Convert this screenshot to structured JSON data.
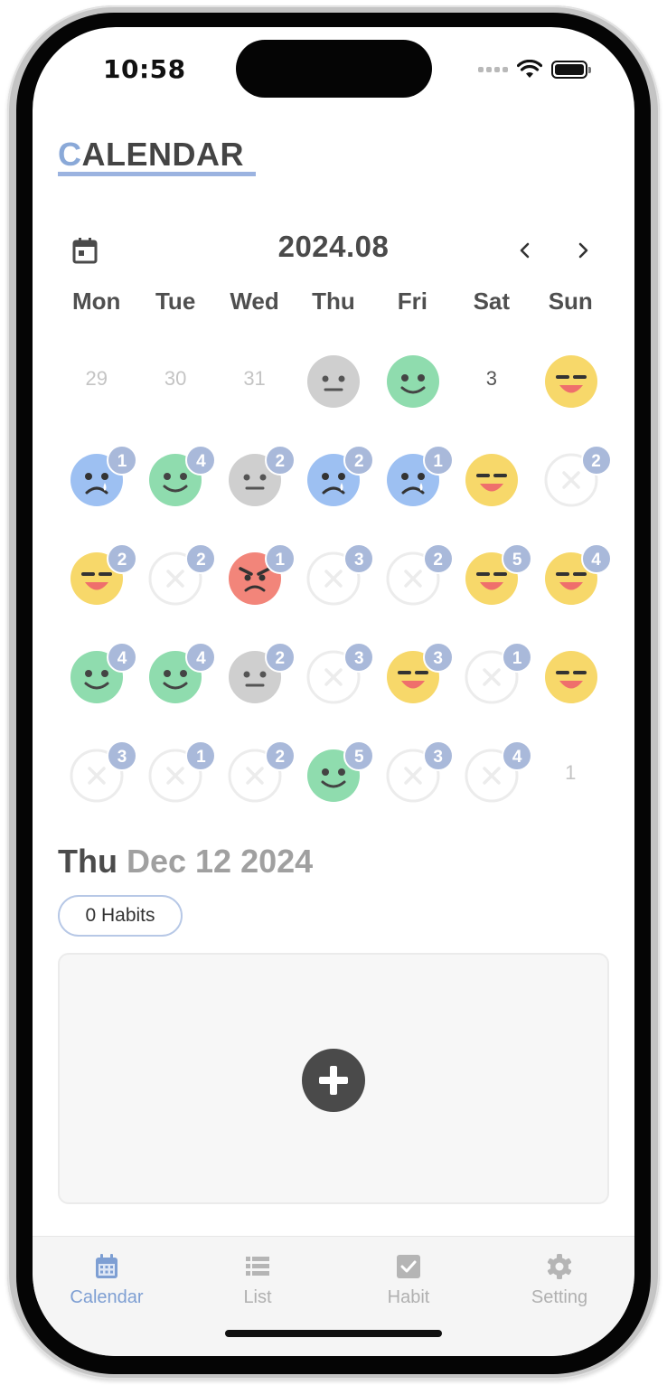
{
  "status": {
    "time": "10:58"
  },
  "header": {
    "title_first": "C",
    "title_rest": "ALENDAR"
  },
  "calendar": {
    "month": "2024.08",
    "weekdays": [
      "Mon",
      "Tue",
      "Wed",
      "Thu",
      "Fri",
      "Sat",
      "Sun"
    ],
    "weeks": [
      [
        {
          "day": "29",
          "mood": "none",
          "muted": true
        },
        {
          "day": "30",
          "mood": "none",
          "muted": true
        },
        {
          "day": "31",
          "mood": "none",
          "muted": true
        },
        {
          "mood": "neutral"
        },
        {
          "mood": "happy"
        },
        {
          "day": "3",
          "mood": "none"
        },
        {
          "mood": "smug"
        }
      ],
      [
        {
          "mood": "sad",
          "count": "1"
        },
        {
          "mood": "happy",
          "count": "4"
        },
        {
          "mood": "neutral",
          "count": "2"
        },
        {
          "mood": "sad",
          "count": "2"
        },
        {
          "mood": "sad",
          "count": "1"
        },
        {
          "mood": "smug"
        },
        {
          "mood": "empty",
          "count": "2"
        }
      ],
      [
        {
          "mood": "smug",
          "count": "2"
        },
        {
          "mood": "empty",
          "count": "2"
        },
        {
          "mood": "angry",
          "count": "1"
        },
        {
          "mood": "empty",
          "count": "3"
        },
        {
          "mood": "empty",
          "count": "2"
        },
        {
          "mood": "smug",
          "count": "5"
        },
        {
          "mood": "smug",
          "count": "4"
        }
      ],
      [
        {
          "mood": "happy",
          "count": "4"
        },
        {
          "mood": "happy",
          "count": "4"
        },
        {
          "mood": "neutral",
          "count": "2"
        },
        {
          "mood": "empty",
          "count": "3"
        },
        {
          "mood": "smug",
          "count": "3"
        },
        {
          "mood": "empty",
          "count": "1"
        },
        {
          "mood": "smug"
        }
      ],
      [
        {
          "mood": "empty",
          "count": "3"
        },
        {
          "mood": "empty",
          "count": "1"
        },
        {
          "mood": "empty",
          "count": "2"
        },
        {
          "mood": "happy",
          "count": "5"
        },
        {
          "mood": "empty",
          "count": "3"
        },
        {
          "mood": "empty",
          "count": "4"
        },
        {
          "day": "1",
          "mood": "none",
          "muted": true
        }
      ]
    ],
    "mood_colors": {
      "neutral": "#cfcfcf",
      "happy": "#8fdcae",
      "smug": "#f7d86a",
      "sad": "#9dc0f2",
      "angry": "#f2857a"
    }
  },
  "selected": {
    "weekday": "Thu",
    "date": "Dec 12 2024"
  },
  "habits": {
    "count_label": "0 Habits"
  },
  "tabs": [
    {
      "label": "Calendar",
      "icon": "calendar-icon",
      "active": true
    },
    {
      "label": "List",
      "icon": "list-icon",
      "active": false
    },
    {
      "label": "Habit",
      "icon": "checkbox-icon",
      "active": false
    },
    {
      "label": "Setting",
      "icon": "gear-icon",
      "active": false
    }
  ],
  "colors": {
    "accent": "#7e9fd3",
    "badge": "#a9b9da"
  }
}
